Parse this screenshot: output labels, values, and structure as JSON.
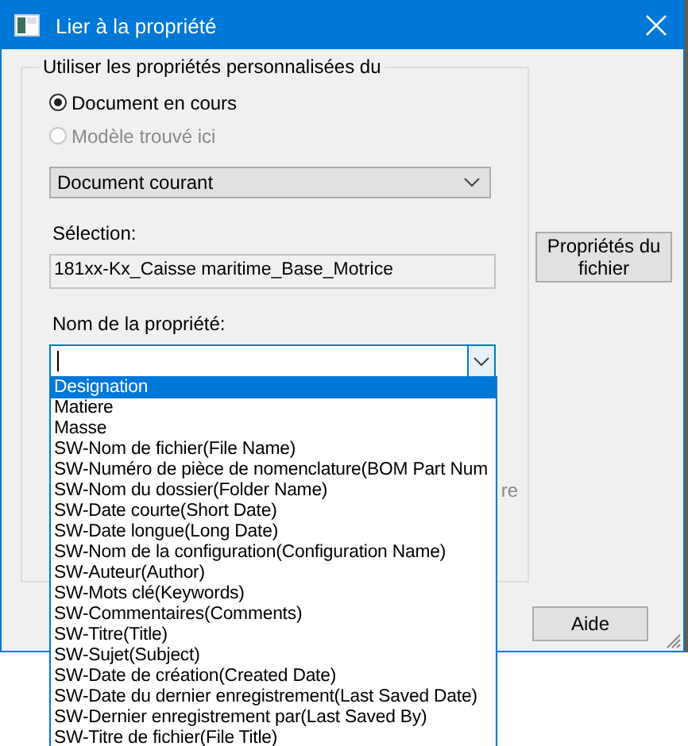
{
  "window": {
    "title": "Lier à la propriété"
  },
  "group": {
    "title": "Utiliser les propriétés personnalisées du",
    "radios": [
      {
        "label": "Document en cours",
        "selected": true,
        "disabled": false
      },
      {
        "label": "Modèle trouvé ici",
        "selected": false,
        "disabled": true
      }
    ],
    "source_dropdown": {
      "value": "Document courant"
    },
    "selection": {
      "label": "Sélection:",
      "value": "181xx-Kx_Caisse maritime_Base_Motrice"
    },
    "property": {
      "label": "Nom de la propriété:",
      "expanded": true,
      "options": [
        {
          "label": "Designation",
          "selected": true
        },
        {
          "label": "Matiere",
          "selected": false
        },
        {
          "label": "Masse",
          "selected": false
        },
        {
          "label": "SW-Nom de fichier(File Name)",
          "selected": false
        },
        {
          "label": "SW-Numéro de pièce de nomenclature(BOM Part Num",
          "selected": false
        },
        {
          "label": "SW-Nom du dossier(Folder Name)",
          "selected": false
        },
        {
          "label": "SW-Date courte(Short Date)",
          "selected": false
        },
        {
          "label": "SW-Date longue(Long Date)",
          "selected": false
        },
        {
          "label": "SW-Nom de la configuration(Configuration Name)",
          "selected": false
        },
        {
          "label": "SW-Auteur(Author)",
          "selected": false
        },
        {
          "label": "SW-Mots clé(Keywords)",
          "selected": false
        },
        {
          "label": "SW-Commentaires(Comments)",
          "selected": false
        },
        {
          "label": "SW-Titre(Title)",
          "selected": false
        },
        {
          "label": "SW-Sujet(Subject)",
          "selected": false
        },
        {
          "label": "SW-Date de création(Created Date)",
          "selected": false
        },
        {
          "label": "SW-Date du dernier enregistrement(Last Saved Date)",
          "selected": false
        },
        {
          "label": "SW-Dernier enregistrement par(Last Saved By)",
          "selected": false
        },
        {
          "label": "SW-Titre de fichier(File Title)",
          "selected": false
        }
      ]
    },
    "hidden_label": "re"
  },
  "buttons": {
    "file_properties": "Propriétés du fichier",
    "help": "Aide"
  }
}
